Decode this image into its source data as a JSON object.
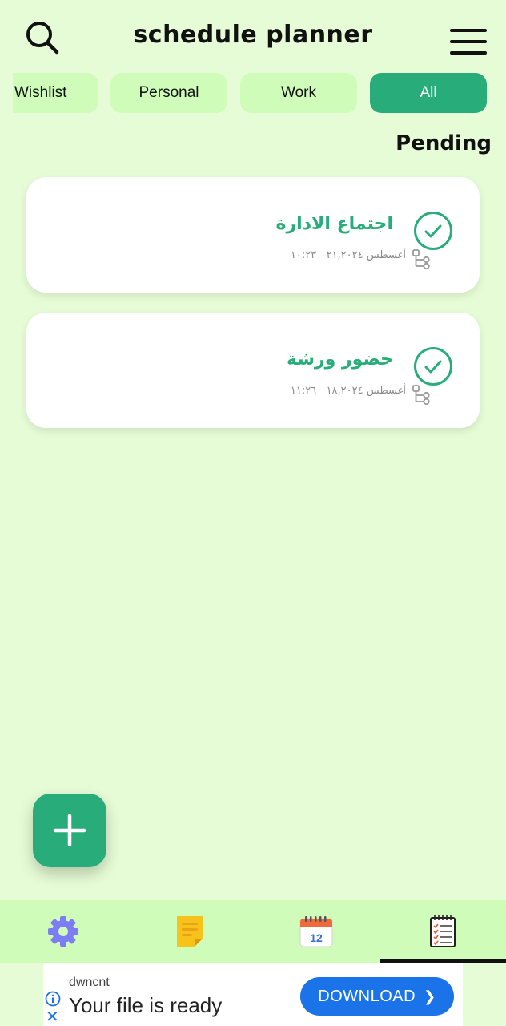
{
  "header": {
    "title": "schedule planner",
    "search_icon": "search-icon",
    "menu_icon": "hamburger-menu-icon"
  },
  "filters": {
    "chips": [
      "Wishlist",
      "Personal",
      "Work",
      "All"
    ],
    "active": "All"
  },
  "section": {
    "title": "Pending"
  },
  "tasks": [
    {
      "title": "اجتماع الادارة",
      "date": "أغسطس ٢١,٢٠٢٤",
      "time": "١٠:٢٣"
    },
    {
      "title": "حضور ورشة",
      "date": "أغسطس ١٨,٢٠٢٤",
      "time": "١١:٢٦"
    }
  ],
  "calendar_day": "12",
  "bottom_nav": {
    "items": [
      "settings-icon",
      "notes-icon",
      "calendar-icon",
      "task-list-icon"
    ],
    "active": "task-list-icon"
  },
  "ad": {
    "brand": "dwncnt",
    "headline": "Your file is ready",
    "cta": "DOWNLOAD",
    "close": "✕"
  },
  "colors": {
    "background": "#e6fcd6",
    "chip": "#cffcb8",
    "accent": "#28ad7a",
    "ad_button": "#1a73e8"
  }
}
